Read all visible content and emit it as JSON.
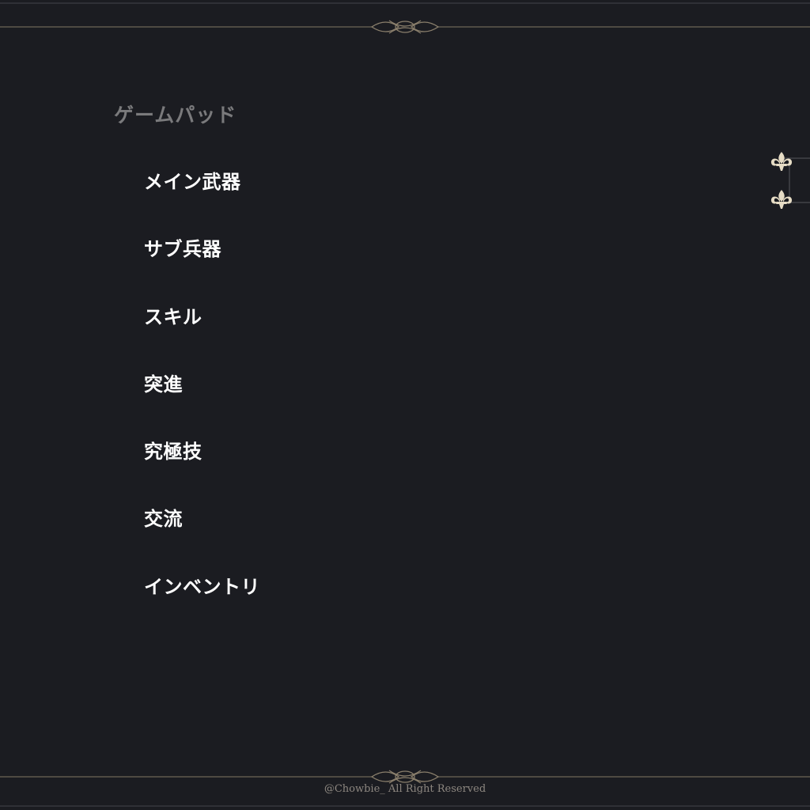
{
  "settings": {
    "section_title": "ゲームパッド",
    "menu_items": [
      {
        "label": "メイン武器"
      },
      {
        "label": "サブ兵器"
      },
      {
        "label": "スキル"
      },
      {
        "label": "突進"
      },
      {
        "label": "究極技"
      },
      {
        "label": "交流"
      },
      {
        "label": "インベントリ"
      }
    ]
  },
  "side_tabs": [
    {
      "icon": "fleur-de-lis-icon"
    },
    {
      "icon": "fleur-de-lis-icon"
    }
  ],
  "footer": {
    "copyright": "@Chowbie_  All Right Reserved"
  },
  "colors": {
    "background": "#1b1c21",
    "ornament": "#8a7f6c",
    "icon": "#e6dcc5",
    "title": "#7a7a7c",
    "item": "#ffffff",
    "footer_text": "#8d8780"
  }
}
